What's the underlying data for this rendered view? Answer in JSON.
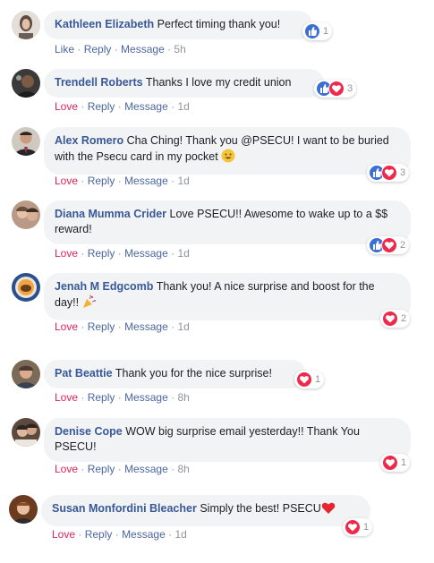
{
  "colors": {
    "author": "#385898",
    "link": "#4b67a1",
    "love": "#e0245e",
    "bubble": "#f2f3f5"
  },
  "comments": [
    {
      "author": "Kathleen Elizabeth",
      "text": "Perfect timing thank you!",
      "reaction": "Like",
      "reply": "Reply",
      "message": "Message",
      "time": "5h",
      "reaction_types": [
        "like-icon"
      ],
      "count": "1"
    },
    {
      "author": "Trendell Roberts",
      "text": "Thanks I love my credit union",
      "reaction": "Love",
      "reply": "Reply",
      "message": "Message",
      "time": "1d",
      "reaction_types": [
        "like-icon",
        "love-icon"
      ],
      "count": "3"
    },
    {
      "author": "Alex Romero",
      "text": "Cha Ching! Thank you @PSECU! I want to be buried with the Psecu card in my pocket",
      "emoji": "smile-emoji",
      "reaction": "Love",
      "reply": "Reply",
      "message": "Message",
      "time": "1d",
      "reaction_types": [
        "like-icon",
        "love-icon"
      ],
      "count": "3"
    },
    {
      "author": "Diana Mumma Crider",
      "text": "Love PSECU!! Awesome to wake up to a $$ reward!",
      "reaction": "Love",
      "reply": "Reply",
      "message": "Message",
      "time": "1d",
      "reaction_types": [
        "like-icon",
        "love-icon"
      ],
      "count": "2"
    },
    {
      "author": "Jenah M Edgcomb",
      "text": "Thank you! A nice surprise and boost for the day!!",
      "emoji": "party-popper-emoji",
      "reaction": "Love",
      "reply": "Reply",
      "message": "Message",
      "time": "1d",
      "reaction_types": [
        "love-icon"
      ],
      "count": "2"
    },
    {
      "author": "Pat Beattie",
      "text": "Thank you for the nice surprise!",
      "reaction": "Love",
      "reply": "Reply",
      "message": "Message",
      "time": "8h",
      "reaction_types": [
        "love-icon"
      ],
      "count": "1"
    },
    {
      "author": "Denise Cope",
      "text": "WOW big surprise email yesterday!! Thank You PSECU!",
      "reaction": "Love",
      "reply": "Reply",
      "message": "Message",
      "time": "8h",
      "reaction_types": [
        "love-icon"
      ],
      "count": "1"
    },
    {
      "author": "Susan Monfordini Bleacher",
      "text": "Simply the best! PSECU",
      "emoji": "red-heart-emoji",
      "reaction": "Love",
      "reply": "Reply",
      "message": "Message",
      "time": "1d",
      "reaction_types": [
        "love-icon"
      ],
      "count": "1"
    }
  ]
}
